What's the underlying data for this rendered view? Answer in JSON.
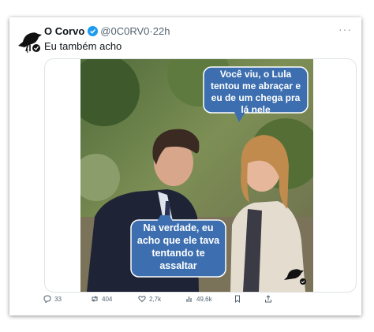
{
  "tweet": {
    "author_name": "O Corvo",
    "handle": "@0C0RV0",
    "separator": "·",
    "time": "22h",
    "text": "Eu também acho",
    "more": "···"
  },
  "media": {
    "bubble_top": "Você viu, o Lula tentou me abraçar e eu de um chega pra lá nele",
    "bubble_bottom": "Na verdade, eu acho que ele tava tentando te assaltar",
    "bubble_color": "#3d6fb0"
  },
  "actions": {
    "replies": "33",
    "retweets": "404",
    "likes": "2,7k",
    "views": "49,6k"
  },
  "colors": {
    "verified": "#1d9bf0",
    "muted": "#536471"
  }
}
